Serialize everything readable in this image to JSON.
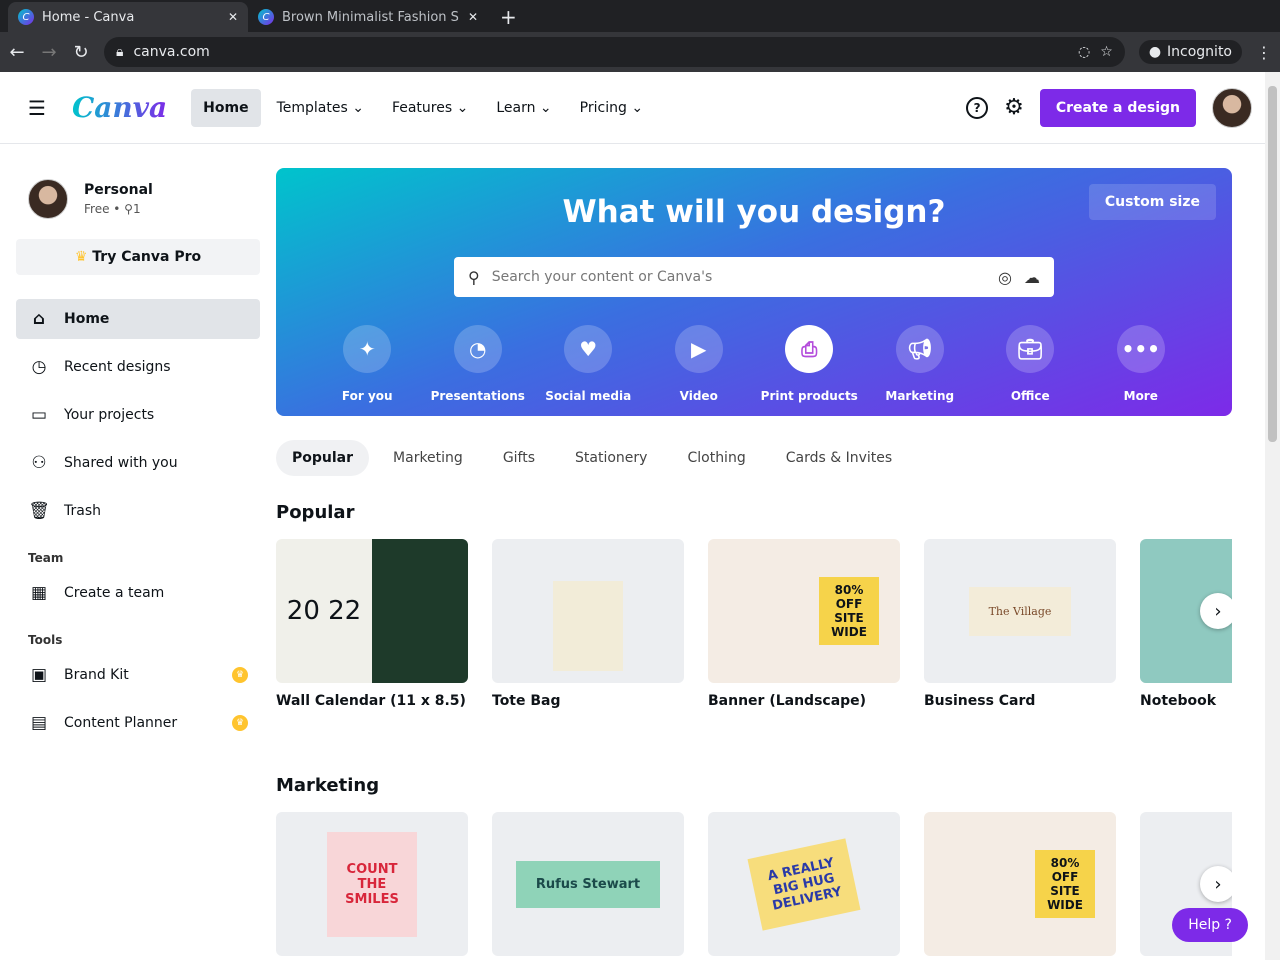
{
  "browser": {
    "tabs": [
      {
        "title": "Home - Canva"
      },
      {
        "title": "Brown Minimalist Fashion S"
      }
    ],
    "url": "canva.com",
    "incognito": "Incognito"
  },
  "header": {
    "logo": "Canva",
    "nav": [
      "Home",
      "Templates",
      "Features",
      "Learn",
      "Pricing"
    ],
    "create": "Create a design"
  },
  "sidebar": {
    "name": "Personal",
    "plan": "Free • ",
    "members": "1",
    "try_pro": "Try Canva Pro",
    "items": [
      "Home",
      "Recent designs",
      "Your projects",
      "Shared with you",
      "Trash"
    ],
    "team_heading": "Team",
    "team_items": [
      "Create a team"
    ],
    "tools_heading": "Tools",
    "tools": [
      "Brand Kit",
      "Content Planner"
    ]
  },
  "hero": {
    "title": "What will you design?",
    "custom_size": "Custom size",
    "search_placeholder": "Search your content or Canva's",
    "categories": [
      "For you",
      "Presentations",
      "Social media",
      "Video",
      "Print products",
      "Marketing",
      "Office",
      "More"
    ]
  },
  "chips": [
    "Popular",
    "Marketing",
    "Gifts",
    "Stationery",
    "Clothing",
    "Cards & Invites"
  ],
  "popular": {
    "title": "Popular",
    "items": [
      "Wall Calendar (11 x 8.5)",
      "Tote Bag",
      "Banner (Landscape)",
      "Business Card",
      "Notebook"
    ]
  },
  "marketing": {
    "title": "Marketing"
  },
  "thumbs": {
    "calendar": "20 22",
    "banner": "80% OFF SITE WIDE",
    "card": "The Village",
    "m1": "COUNT THE SMILES",
    "m2": "Rufus Stewart",
    "m3": "A REALLY BIG HUG DELIVERY",
    "m4": "80% OFF SITE WIDE"
  },
  "help": "Help ?",
  "colors": {
    "accent": "#7d2ae8",
    "teal": "#00c4cc"
  }
}
